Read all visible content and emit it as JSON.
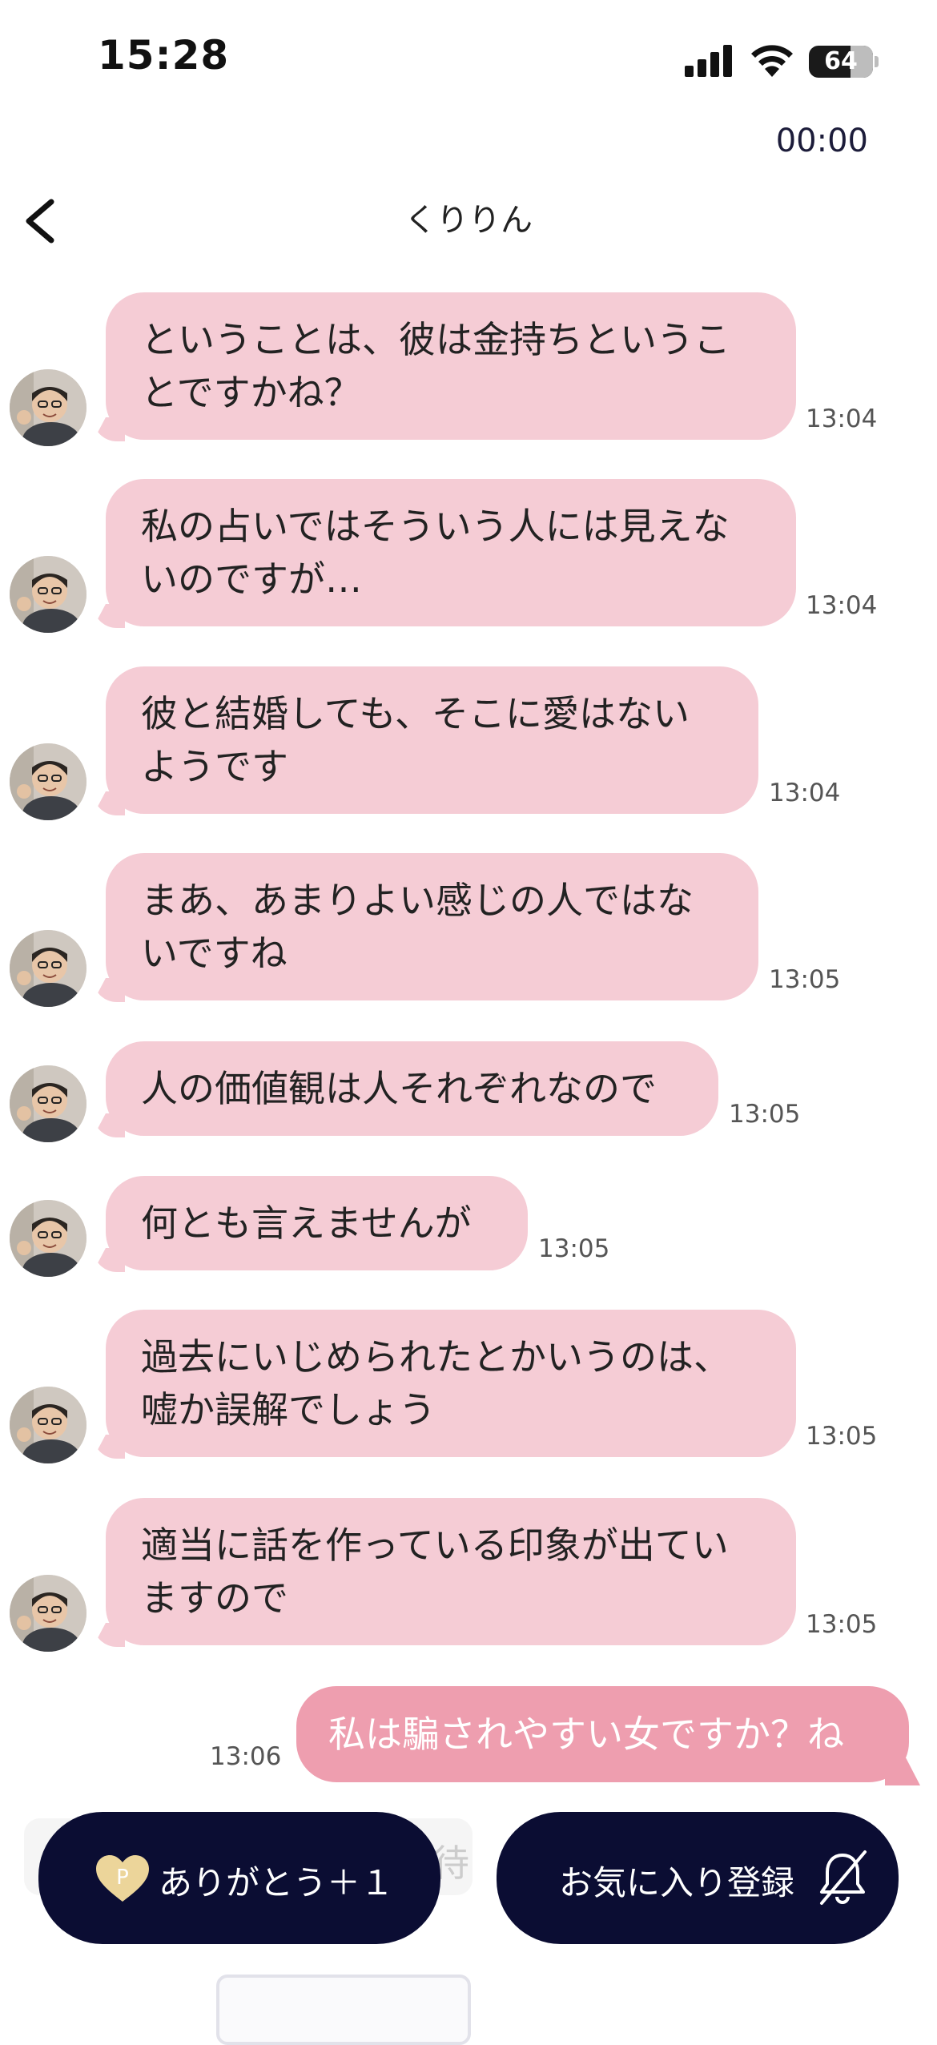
{
  "status_bar": {
    "clock": "15:28",
    "battery": "64",
    "icons": [
      "signal-icon",
      "wifi-icon",
      "battery-icon"
    ]
  },
  "call_timer": "00:00",
  "header": {
    "title": "くりりん",
    "back_icon": "chevron-left-icon"
  },
  "messages": [
    {
      "text": "ということは、彼は金持ちということですかね？",
      "lines": [
        "ということは、彼は金持ちというこ",
        "とですかね？"
      ],
      "time": "13:04"
    },
    {
      "text": "私の占いではそういう人には見えないのですが…",
      "lines": [
        "私の占いではそういう人には見えな",
        "いのですが…"
      ],
      "time": "13:04"
    },
    {
      "text": "彼と結婚しても、そこに愛はないようです",
      "lines": [
        "彼と結婚しても、そこに愛はない",
        "ようです"
      ],
      "time": "13:04"
    },
    {
      "text": "まあ、あまりよい感じの人ではないですね",
      "lines": [
        "まあ、あまりよい感じの人ではな",
        "いですね"
      ],
      "time": "13:05"
    },
    {
      "text": "人の価値観は人それぞれなので",
      "lines": [
        "人の価値観は人それぞれなので"
      ],
      "time": "13:05"
    },
    {
      "text": "何とも言えませんが",
      "lines": [
        "何とも言えませんが"
      ],
      "time": "13:05"
    },
    {
      "text": "過去にいじめられたとかいうのは、嘘か誤解でしょう",
      "lines": [
        "過去にいじめられたとかいうのは、",
        "嘘か誤解でしょう"
      ],
      "time": "13:05"
    },
    {
      "text": "適当に話を作っている印象が出ていますので",
      "lines": [
        "適当に話を作っている印象が出てい",
        "ますので"
      ],
      "time": "13:05"
    }
  ],
  "outgoing": {
    "text": "私は騙されやすい女ですか？ね",
    "time": "13:06"
  },
  "input_ghost": "待",
  "actions": {
    "thanks_label": "ありがとう＋１",
    "thanks_icon": "heart-points-icon",
    "favorite_label": "お気に入り登録",
    "favorite_icon": "bell-off-icon"
  },
  "colors": {
    "incoming_bubble": "#f5ccd5",
    "outgoing_bubble": "#ee9eaf",
    "action_button": "#0b0d33"
  }
}
